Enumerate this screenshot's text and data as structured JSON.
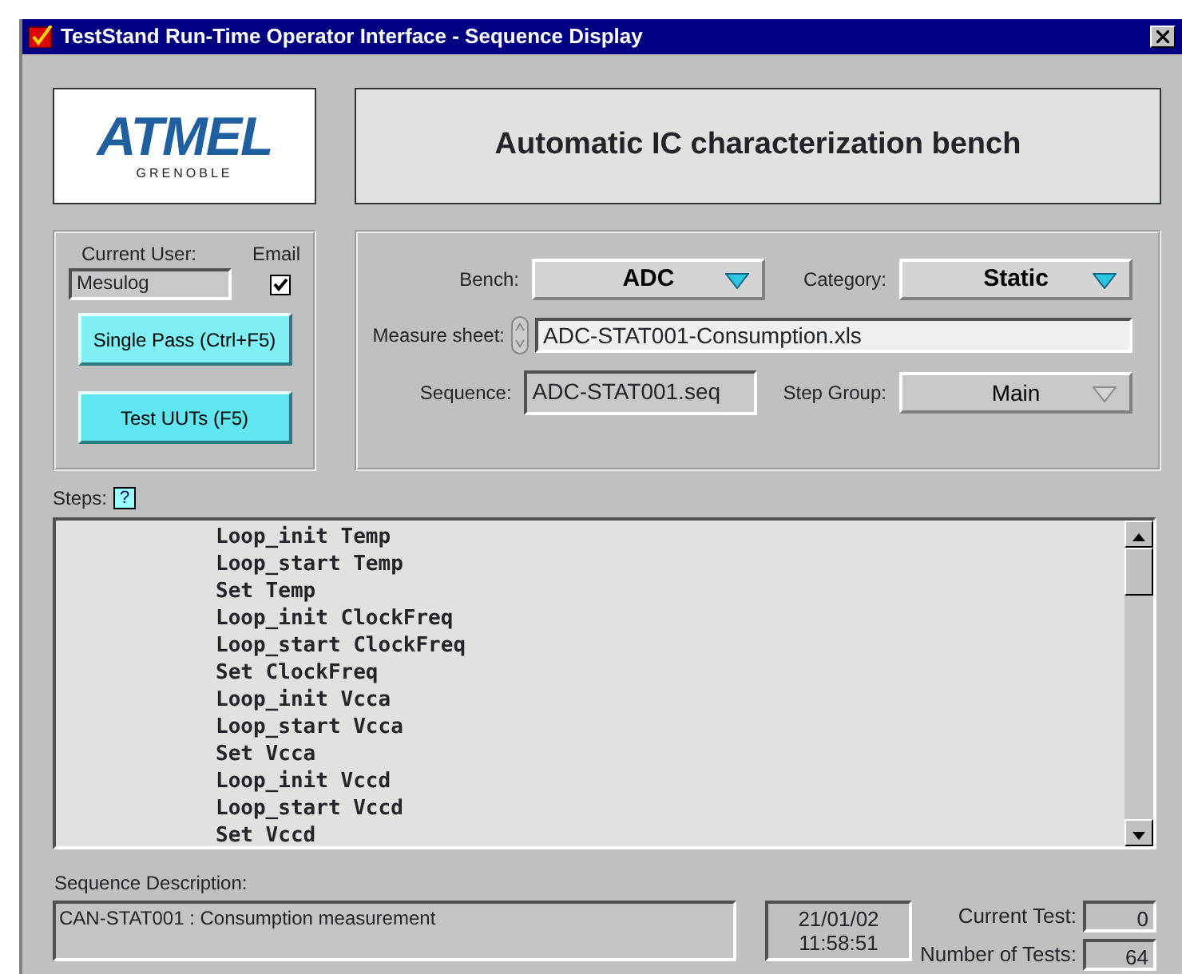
{
  "window": {
    "title": "TestStand Run-Time Operator Interface - Sequence Display"
  },
  "logo": {
    "name": "ATMEL",
    "subtitle": "GRENOBLE"
  },
  "heading": "Automatic IC characterization bench",
  "user": {
    "label": "Current User:",
    "value": "Mesulog",
    "email_label": "Email",
    "email_checked": true
  },
  "buttons": [
    {
      "label": "Single Pass (Ctrl+F5)"
    },
    {
      "label": "Test UUTs (F5)"
    }
  ],
  "bench": {
    "label": "Bench:",
    "value": "ADC",
    "disabled": false
  },
  "category": {
    "label": "Category:",
    "value": "Static",
    "disabled": false
  },
  "measure_sheet": {
    "label": "Measure sheet:",
    "value": "ADC-STAT001-Consumption.xls"
  },
  "sequence": {
    "label": "Sequence:",
    "value": "ADC-STAT001.seq"
  },
  "step_group": {
    "label": "Step Group:",
    "value": "Main",
    "disabled": true
  },
  "steps": {
    "label": "Steps:",
    "help": "?",
    "items": [
      "Loop_init Temp",
      "Loop_start Temp",
      "Set Temp",
      "Loop_init ClockFreq",
      "Loop_start ClockFreq",
      "Set ClockFreq",
      "Loop_init Vcca",
      "Loop_start Vcca",
      "Set Vcca",
      "Loop_init Vccd",
      "Loop_start Vccd",
      "Set Vccd"
    ]
  },
  "description": {
    "label": "Sequence Description:",
    "value": "CAN-STAT001 : Consumption measurement"
  },
  "date": "21/01/02",
  "time": "11:58:51",
  "current_test": {
    "label": "Current Test:",
    "value": "0"
  },
  "number_of_tests": {
    "label": "Number of Tests:",
    "value": "64"
  }
}
